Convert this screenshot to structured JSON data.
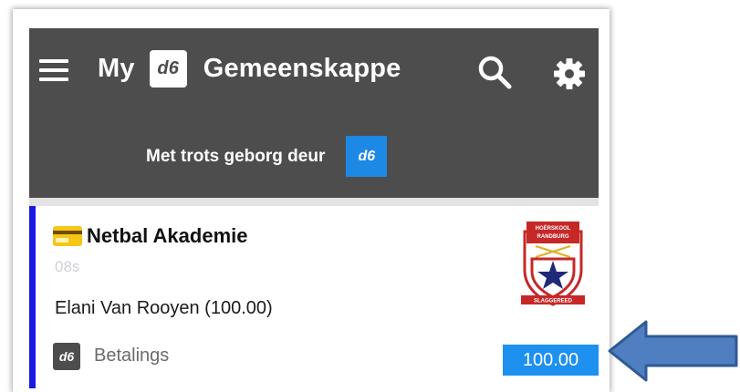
{
  "header": {
    "title_prefix": "My",
    "logo_text": "d6",
    "title_suffix": "Gemeenskappe",
    "pride_text": "Met trots geborg deur",
    "pride_logo_text": "d6"
  },
  "card": {
    "title": "Netbal Akademie",
    "subtitle": "08s",
    "person": "Elani Van Rooyen (100.00)",
    "footer_logo_text": "d6",
    "footer_label": "Betalings",
    "amount": "100.00",
    "accent_color": "#1a1ae6"
  },
  "crest": {
    "top_text": "HOËRSKOOL",
    "top_text2": "RANDBURG",
    "motto": "SLAGGEREED"
  },
  "colors": {
    "appbar": "#4d4d4d",
    "badge": "#1e90f0",
    "arrow": "#4f7fc0"
  },
  "icons": [
    "menu-icon",
    "search-icon",
    "gear-icon",
    "credit-card-icon",
    "school-crest-icon",
    "pointer-arrow-icon"
  ]
}
